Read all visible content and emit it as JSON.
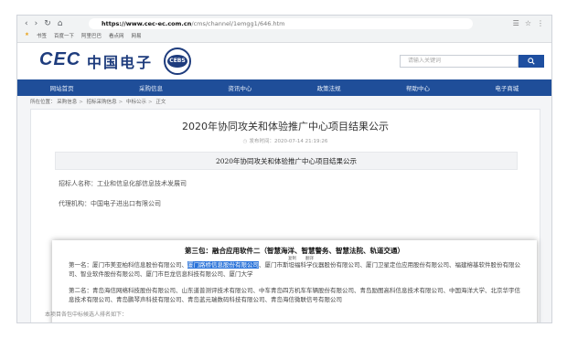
{
  "browser": {
    "nav": {
      "back": "‹",
      "forward": "›",
      "reload": "↻",
      "home": "⌂"
    },
    "url_host": "https://www.cec-ec.com.cn",
    "url_path": "/cms/channel/1emgg1/646.htm",
    "bookmarks": [
      "★",
      "书签",
      "百度一下",
      "阿里巴巴",
      "看点网",
      "网易"
    ],
    "icons": [
      "☰",
      "☆",
      "⋮"
    ]
  },
  "site": {
    "logo_text": "CEC",
    "logo_cn": "中国电子",
    "badge_text": "CEBS",
    "search_placeholder": "请输入关键词",
    "search_icon": "search-icon"
  },
  "navbar": {
    "items": [
      "网站首页",
      "采购信息",
      "资讯中心",
      "政策法规",
      "帮助中心",
      "电子商城"
    ]
  },
  "breadcrumb": {
    "label": "所在位置：",
    "items": [
      "采购信息",
      "招标采购信息",
      "中标公示",
      "正文"
    ]
  },
  "article": {
    "title": "2020年协同攻关和体验推广中心项目结果公示",
    "publish_label": "发布时间：",
    "publish_time": "2020-07-14 21:19:26",
    "doc_title": "2020年协同攻关和体验推广中心项目结果公示",
    "tenderer": "招标人名称：工业和信息化部信息技术发展司",
    "agency": "代理机构：中国电子进出口有限公司",
    "package_heading": "第三包：融合应用软件二（智慧海洋、智慧警务、智慧法院、轨道交通）",
    "mini_labels": [
      "复制",
      "翻译"
    ],
    "first_prefix": "第一名：厦门市美亚柏科信息股份有限公司、",
    "first_highlight": "厦门路桥信息股份有限公司",
    "first_suffix": "、厦门市斯坦福科学仪器股份有限公司、厦门卫星定位应用股份有限公司、福建榕基软件股份有限公司、智业软件股份有限公司、厦门市巨龙信息科技有限公司、厦门大学",
    "second": "第二名：青岛海信网络科技股份有限公司、山东道普测评技术有限公司、中车青岛四方机车车辆股份有限公司、青岛励图高科信息技术有限公司、中国海洋大学、北京华宇信息技术有限公司、青岛鹏琴声科技有限公司、青岛蓝元瑞数码科技有限公司、青岛海信微联信号有限公司",
    "footer_line": "本项目各包中标候选人排名如下："
  }
}
